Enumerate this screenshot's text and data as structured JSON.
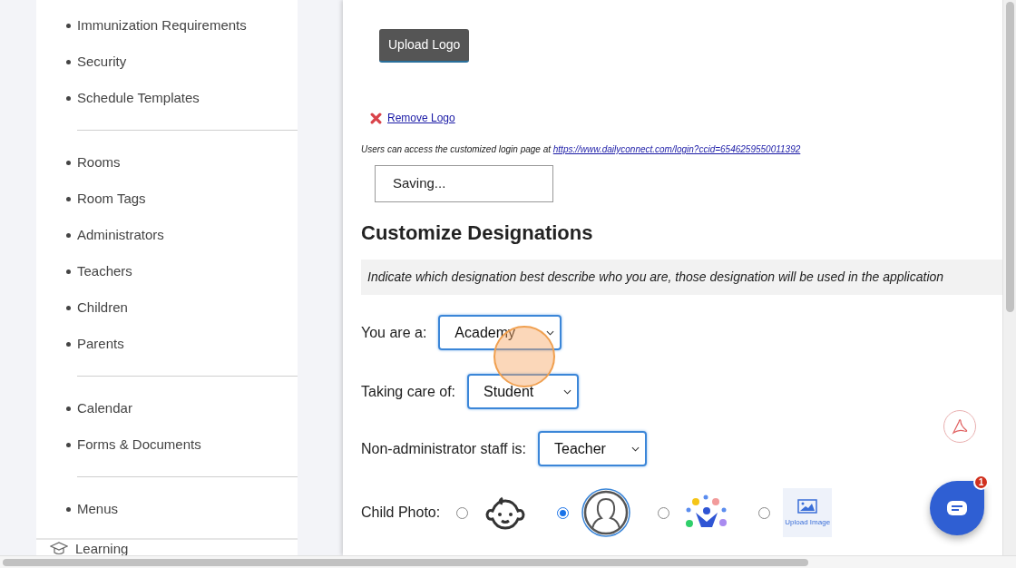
{
  "sidebar": {
    "groups": [
      {
        "items": [
          "Immunization Requirements",
          "Security",
          "Schedule Templates"
        ]
      },
      {
        "items": [
          "Rooms",
          "Room Tags",
          "Administrators",
          "Teachers",
          "Children",
          "Parents"
        ]
      },
      {
        "items": [
          "Calendar",
          "Forms & Documents"
        ]
      },
      {
        "items": [
          "Menus"
        ]
      }
    ],
    "section": {
      "label": "Learning"
    }
  },
  "logo": {
    "upload_button": "Upload Logo",
    "remove_link": "Remove Logo",
    "login_note": "Users can access the customized login page at",
    "login_url": "https://www.dailyconnect.com/login?ccid=6546259550011392",
    "status_field": "Saving..."
  },
  "designations": {
    "title": "Customize Designations",
    "hint": "Indicate which designation best describe who you are, those designation will be used in the application",
    "selects": [
      {
        "label": "You are a:",
        "value": "Academy"
      },
      {
        "label": "Taking care of:",
        "value": "Student"
      },
      {
        "label": "Non-administrator staff is:",
        "value": "Teacher"
      }
    ],
    "child_photo": {
      "label": "Child Photo:",
      "options": [
        {
          "kind": "baby",
          "selected": false
        },
        {
          "kind": "person",
          "selected": true
        },
        {
          "kind": "group",
          "selected": false
        },
        {
          "kind": "upload",
          "selected": false,
          "caption": "Upload Image"
        }
      ]
    }
  },
  "chat": {
    "badge": "1"
  }
}
